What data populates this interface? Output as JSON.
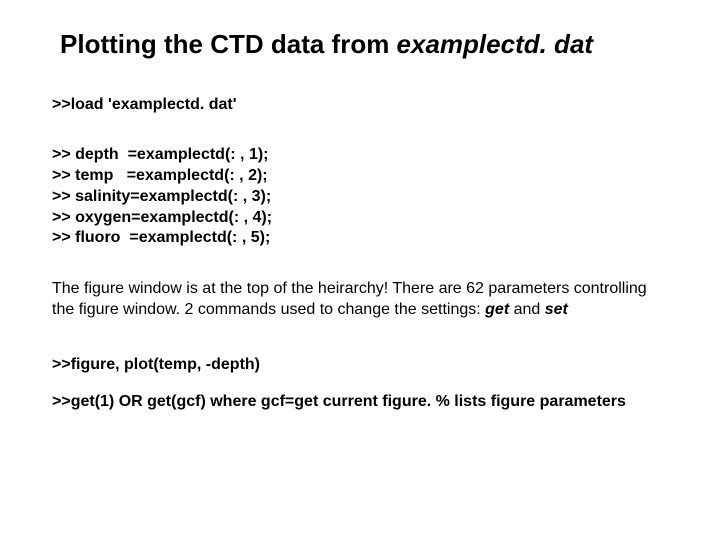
{
  "title_prefix": "Plotting the CTD data from ",
  "title_italic": "examplectd. dat",
  "load_line": ">>load 'examplectd. dat'",
  "assign_lines": ">> depth  =examplectd(: , 1);\n>> temp   =examplectd(: , 2);\n>> salinity=examplectd(: , 3);\n>> oxygen=examplectd(: , 4);\n>> fluoro  =examplectd(: , 5);",
  "para_pre": "The figure window is at the top of the heirarchy! There are 62 parameters controlling the figure window. 2 commands used to change the settings: ",
  "para_get": "get",
  "para_mid": " and ",
  "para_set": "set",
  "plot_line": ">>figure, plot(temp, -depth)",
  "get_line": ">>get(1)   OR get(gcf) where gcf=get current figure. % lists figure parameters"
}
